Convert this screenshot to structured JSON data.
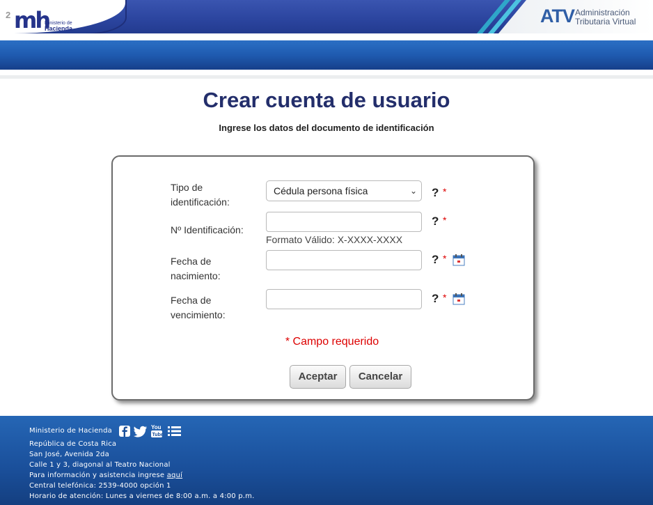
{
  "header": {
    "logo_number": "2",
    "logo_mark": "mh",
    "logo_line1": "Ministerio de",
    "logo_line2": "Hacienda",
    "atv_logo": "ATV",
    "atv_line1": "Administración",
    "atv_line2": "Tributaria Virtual"
  },
  "page": {
    "title": "Crear cuenta de usuario",
    "subtitle": "Ingrese los datos del documento de identificación"
  },
  "form": {
    "tipo_label": "Tipo de identificación:",
    "tipo_value": "Cédula persona física",
    "id_label": "Nº Identificación:",
    "id_value": "",
    "id_hint": "Formato Válido: X-XXXX-XXXX",
    "nacimiento_label": "Fecha de nacimiento:",
    "nacimiento_value": "",
    "vencimiento_label": "Fecha de vencimiento:",
    "vencimiento_value": "",
    "help_symbol": "?",
    "required_symbol": "*",
    "required_note": "* Campo requerido",
    "accept_label": "Aceptar",
    "cancel_label": "Cancelar"
  },
  "footer": {
    "org": "Ministerio de Hacienda",
    "country": "República de Costa Rica",
    "address1": "San José, Avenida 2da",
    "address2": "Calle 1 y 3, diagonal al Teatro Nacional",
    "info_prefix": "Para información y asistencia ingrese",
    "info_link": "aquí",
    "phone": "Central telefónica: 2539-4000 opción 1",
    "hours": "Horario de atención: Lunes a viernes de 8:00 a.m. a 4:00 p.m.",
    "social": [
      "facebook-icon",
      "twitter-icon",
      "youtube-icon",
      "list-icon"
    ]
  },
  "colors": {
    "brand_blue": "#232e6b",
    "required_red": "#dd0000",
    "header_blue": "#2b449e"
  }
}
